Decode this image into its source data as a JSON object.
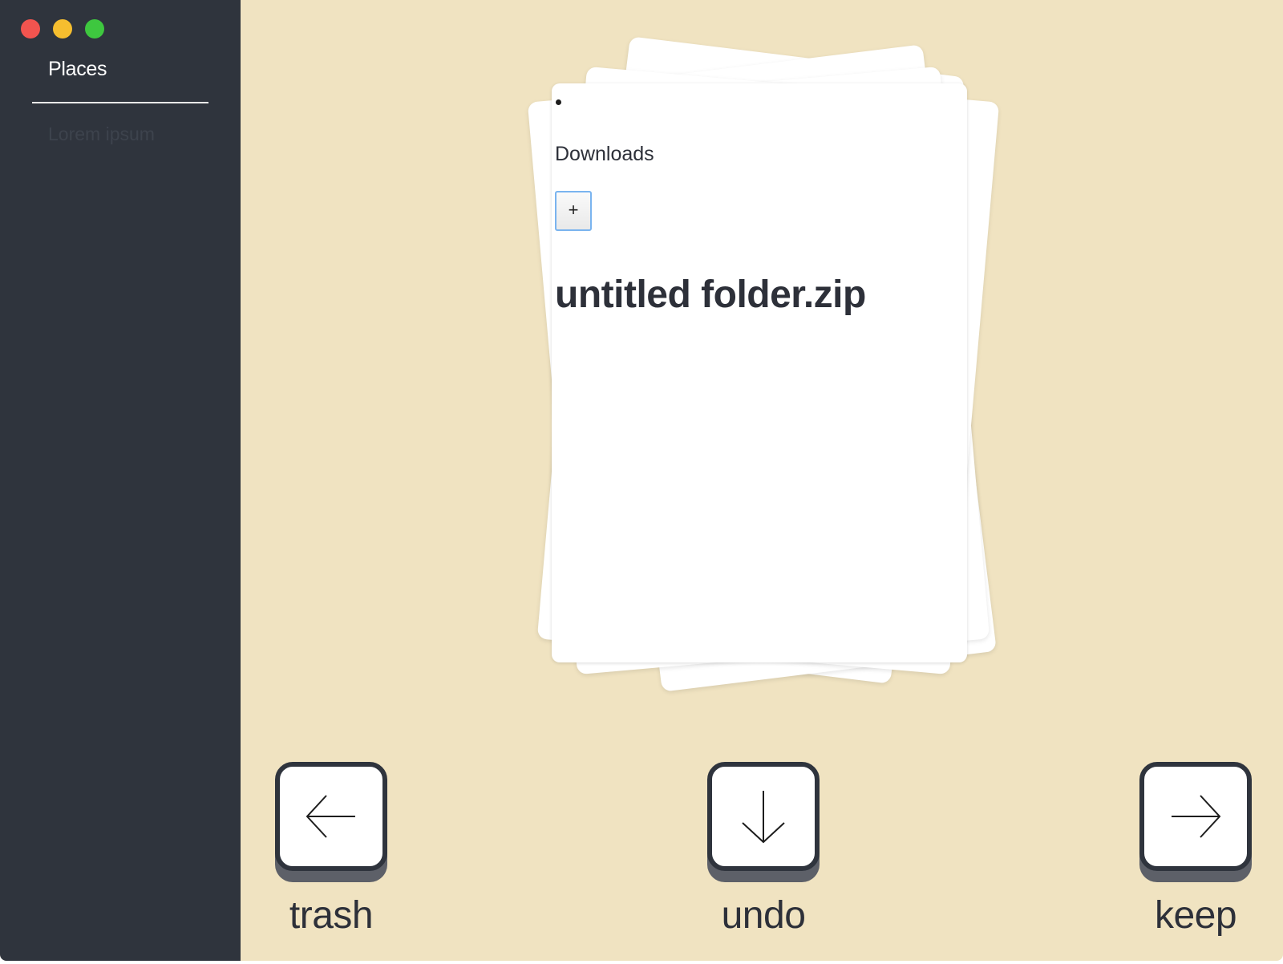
{
  "sidebar": {
    "title": "Places",
    "items": [
      {
        "label": "Lorem ipsum"
      }
    ]
  },
  "card": {
    "folder": "Downloads",
    "add_label": "+",
    "file": "untitled folder.zip"
  },
  "actions": {
    "trash": {
      "label": "trash",
      "icon": "arrow-left-icon"
    },
    "undo": {
      "label": "undo",
      "icon": "arrow-down-icon"
    },
    "keep": {
      "label": "keep",
      "icon": "arrow-right-icon"
    }
  },
  "colors": {
    "sidebar_bg": "#2f343d",
    "main_bg": "#f0e3c1",
    "text_dark": "#2d3039",
    "traffic_close": "#f2544f",
    "traffic_min": "#f6be2f",
    "traffic_max": "#3ec73f"
  }
}
